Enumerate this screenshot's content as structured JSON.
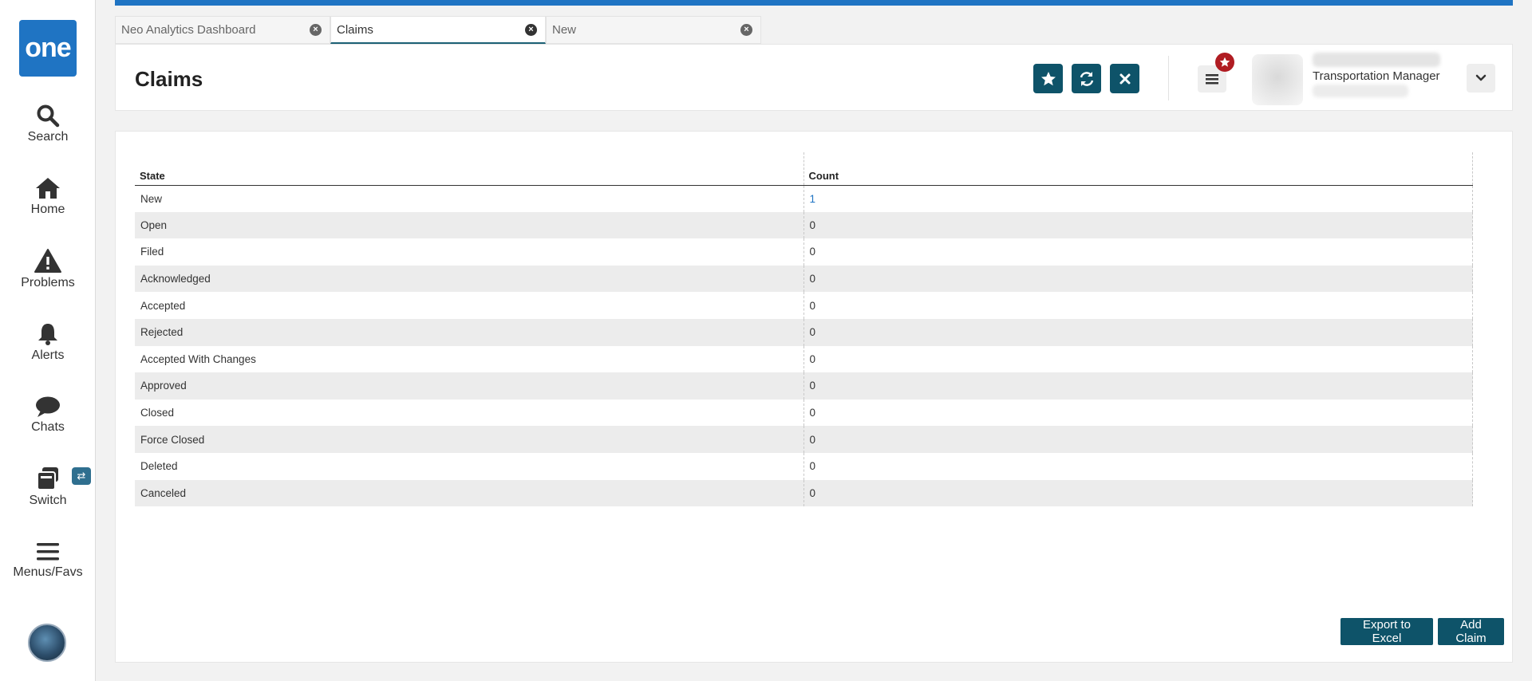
{
  "app": {
    "logo_text": "one",
    "brand_color": "#1f74c3",
    "accent_color": "#0e5369"
  },
  "sidebar": {
    "items": [
      {
        "label": "Search",
        "icon": "search-icon"
      },
      {
        "label": "Home",
        "icon": "home-icon"
      },
      {
        "label": "Problems",
        "icon": "warning-icon"
      },
      {
        "label": "Alerts",
        "icon": "bell-icon"
      },
      {
        "label": "Chats",
        "icon": "chat-icon"
      },
      {
        "label": "Switch",
        "icon": "switch-icon"
      },
      {
        "label": "Menus/Favs",
        "icon": "hamburger-icon"
      }
    ],
    "switch_badge": "⇄"
  },
  "tabs": [
    {
      "label": "Neo Analytics Dashboard",
      "active": false
    },
    {
      "label": "Claims",
      "active": true
    },
    {
      "label": "New",
      "active": false
    }
  ],
  "header": {
    "title": "Claims",
    "user_role": "Transportation Manager"
  },
  "table": {
    "columns": [
      "State",
      "Count"
    ],
    "rows": [
      {
        "state": "New",
        "count": "1"
      },
      {
        "state": "Open",
        "count": "0"
      },
      {
        "state": "Filed",
        "count": "0"
      },
      {
        "state": "Acknowledged",
        "count": "0"
      },
      {
        "state": "Accepted",
        "count": "0"
      },
      {
        "state": "Rejected",
        "count": "0"
      },
      {
        "state": "Accepted With Changes",
        "count": "0"
      },
      {
        "state": "Approved",
        "count": "0"
      },
      {
        "state": "Closed",
        "count": "0"
      },
      {
        "state": "Force Closed",
        "count": "0"
      },
      {
        "state": "Deleted",
        "count": "0"
      },
      {
        "state": "Canceled",
        "count": "0"
      }
    ]
  },
  "actions": {
    "export_label": "Export to Excel",
    "add_label": "Add Claim"
  }
}
